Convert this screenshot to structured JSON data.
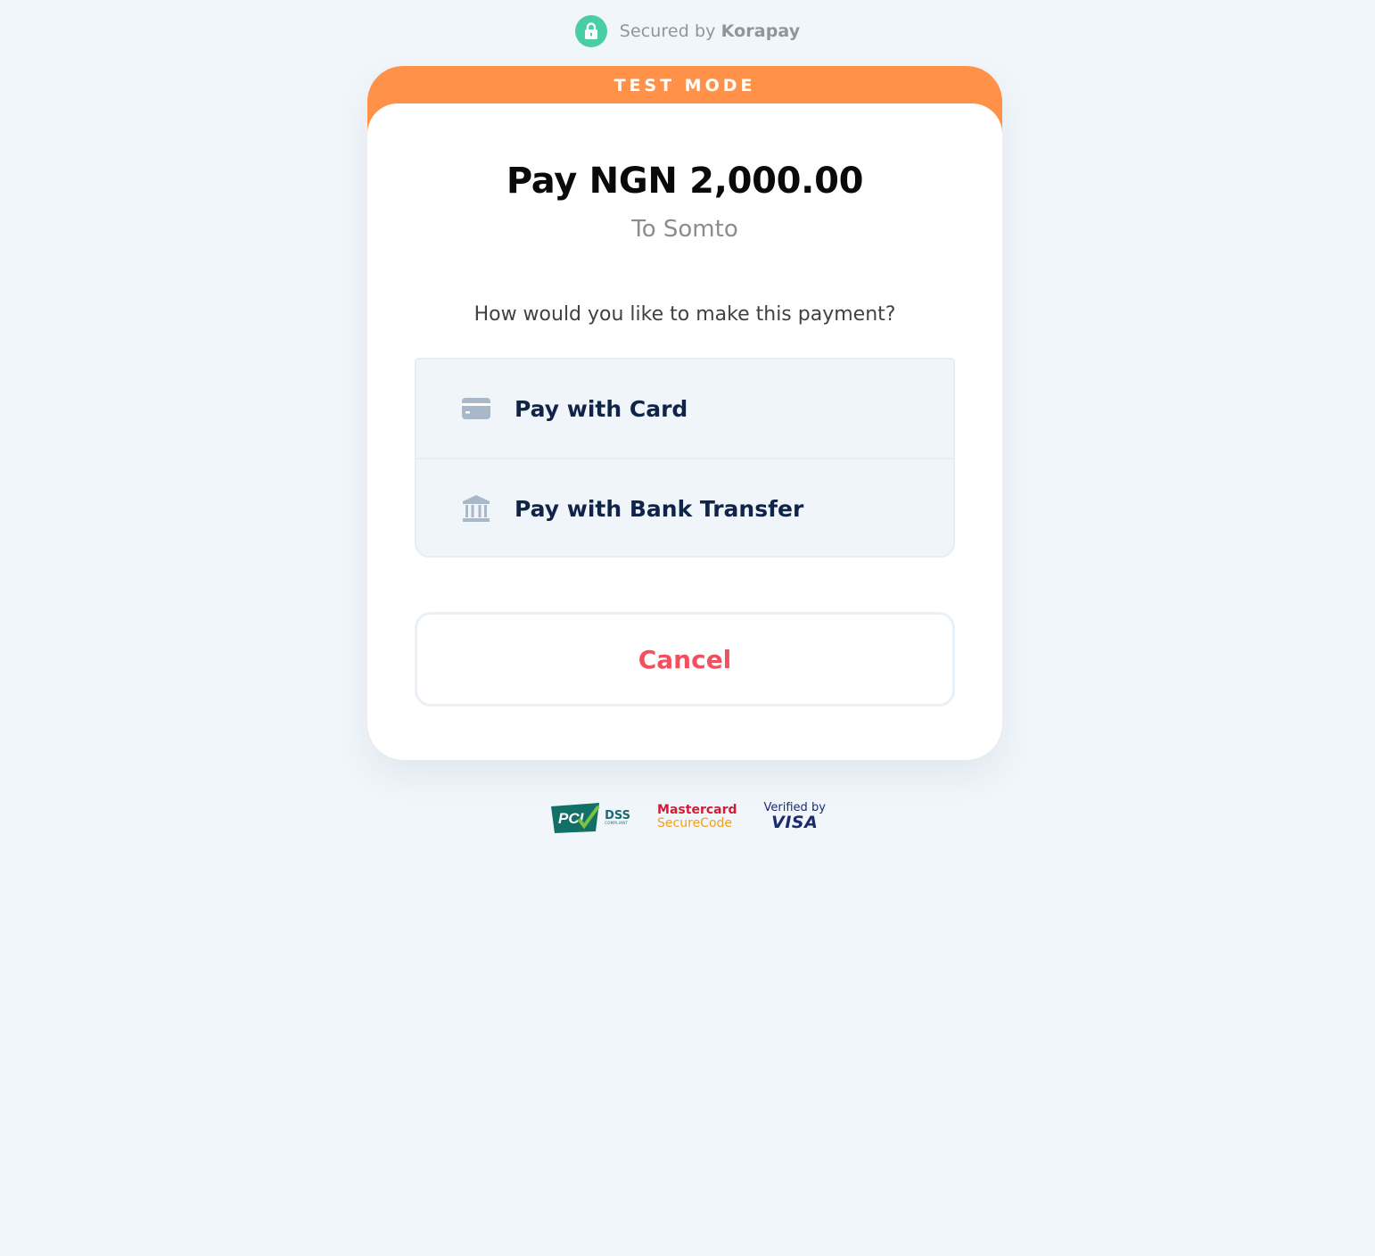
{
  "header": {
    "secured_prefix": "Secured by",
    "secured_brand": "Korapay",
    "lock_color": "#48cea2"
  },
  "banner": {
    "label": "TEST MODE",
    "color": "#ff9248"
  },
  "payment": {
    "amount_label": "Pay NGN 2,000.00",
    "recipient_label": "To Somto",
    "question": "How would you like to make this payment?"
  },
  "options": [
    {
      "label": "Pay with Card",
      "icon": "credit-card-icon"
    },
    {
      "label": "Pay with Bank Transfer",
      "icon": "bank-icon"
    }
  ],
  "cancel": {
    "label": "Cancel",
    "color": "#f2505e"
  },
  "badges": {
    "pci_main": "DSS",
    "pci_sub": "COMPLIANT",
    "pci_logo_text": "PCI",
    "mastercard_top": "Mastercard",
    "mastercard_bottom": "SecureCode",
    "visa_top": "Verified by",
    "visa_bottom": "VISA"
  }
}
